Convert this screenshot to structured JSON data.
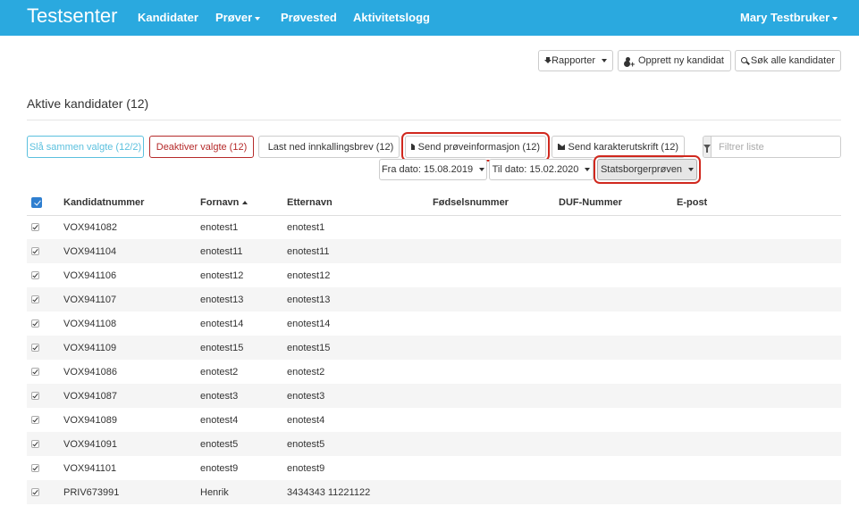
{
  "navbar": {
    "brand": "Testsenter",
    "items": [
      "Kandidater",
      "Prøver",
      "Prøvested",
      "Aktivitetslogg"
    ],
    "user": "Mary Testbruker"
  },
  "toolbar": {
    "reports": "Rapporter",
    "new_candidate": "Opprett ny kandidat",
    "search_all": "Søk alle kandidater"
  },
  "page_title": "Aktive kandidater (12)",
  "actions": {
    "merge": "Slå sammen valgte (12/2)",
    "deactivate": "Deaktiver valgte (12)",
    "download": "Last ned innkallingsbrev (12)",
    "send_info": "Send prøveinformasjon (12)",
    "send_grades": "Send karakterutskrift (12)"
  },
  "filter": {
    "placeholder": "Filtrer liste"
  },
  "dates": {
    "from": "Fra dato: 15.08.2019",
    "to": "Til dato: 15.02.2020",
    "exam": "Statsborgerprøven"
  },
  "table": {
    "headers": {
      "kandidatnummer": "Kandidatnummer",
      "fornavn": "Fornavn",
      "etternavn": "Etternavn",
      "fodselsnummer": "Fødselsnummer",
      "duf": "DUF-Nummer",
      "epost": "E-post"
    },
    "rows": [
      {
        "kandidatnummer": "VOX941082",
        "fornavn": "enotest1",
        "etternavn": "enotest1"
      },
      {
        "kandidatnummer": "VOX941104",
        "fornavn": "enotest11",
        "etternavn": "enotest11"
      },
      {
        "kandidatnummer": "VOX941106",
        "fornavn": "enotest12",
        "etternavn": "enotest12"
      },
      {
        "kandidatnummer": "VOX941107",
        "fornavn": "enotest13",
        "etternavn": "enotest13"
      },
      {
        "kandidatnummer": "VOX941108",
        "fornavn": "enotest14",
        "etternavn": "enotest14"
      },
      {
        "kandidatnummer": "VOX941109",
        "fornavn": "enotest15",
        "etternavn": "enotest15"
      },
      {
        "kandidatnummer": "VOX941086",
        "fornavn": "enotest2",
        "etternavn": "enotest2"
      },
      {
        "kandidatnummer": "VOX941087",
        "fornavn": "enotest3",
        "etternavn": "enotest3"
      },
      {
        "kandidatnummer": "VOX941089",
        "fornavn": "enotest4",
        "etternavn": "enotest4"
      },
      {
        "kandidatnummer": "VOX941091",
        "fornavn": "enotest5",
        "etternavn": "enotest5"
      },
      {
        "kandidatnummer": "VOX941101",
        "fornavn": "enotest9",
        "etternavn": "enotest9"
      },
      {
        "kandidatnummer": "PRIV673991",
        "fornavn": "Henrik",
        "etternavn": "3434343 11221122"
      }
    ]
  },
  "colors": {
    "navbar": "#2aa9df",
    "info_button": "#5bc0de",
    "danger_button": "#b52a2a",
    "highlight": "#d0281e"
  }
}
